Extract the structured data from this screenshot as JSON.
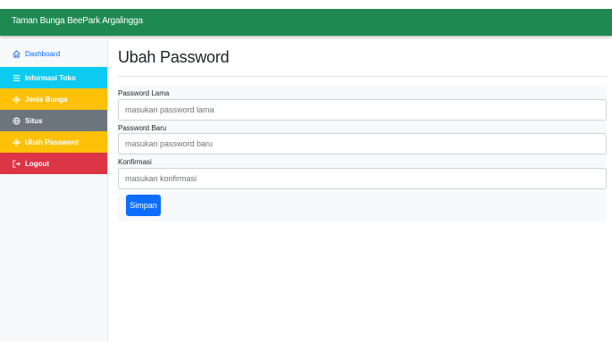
{
  "app": {
    "brand": "Taman Bunga BeePark Argalingga"
  },
  "sidebar": {
    "items": [
      {
        "label": "Dashboard",
        "icon": "home-icon"
      },
      {
        "label": "Informasi Toko",
        "icon": "list-icon"
      },
      {
        "label": "Jenis Bunga",
        "icon": "flower-icon"
      },
      {
        "label": "Situs",
        "icon": "globe-icon"
      },
      {
        "label": "Ubah Password",
        "icon": "flower-icon"
      },
      {
        "label": "Logout",
        "icon": "logout-icon"
      }
    ]
  },
  "main": {
    "title": "Ubah Password",
    "form": {
      "old_password": {
        "label": "Password Lama",
        "placeholder": "masukan password lama"
      },
      "new_password": {
        "label": "Password Baru",
        "placeholder": "masukan password baru"
      },
      "confirm": {
        "label": "Konfirmasi",
        "placeholder": "masukan konfirmasi"
      },
      "submit_label": "Simpan"
    }
  },
  "colors": {
    "topbar": "#1e8a52",
    "info": "#0dcaf0",
    "warning": "#ffc107",
    "secondary": "#6c757d",
    "danger": "#dc3545",
    "primary": "#0d6efd"
  }
}
